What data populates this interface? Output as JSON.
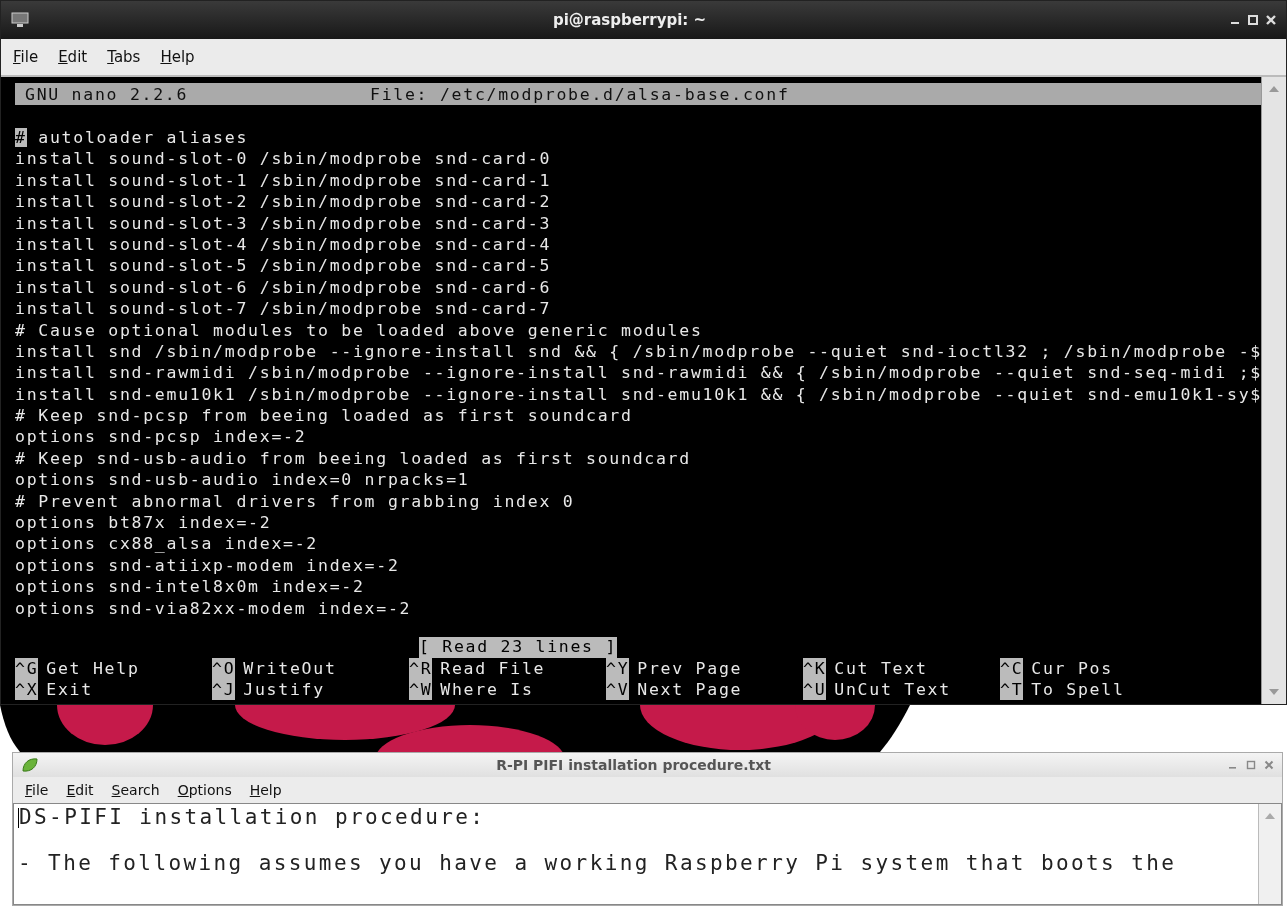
{
  "terminal_window": {
    "title": "pi@raspberrypi: ~",
    "menu": [
      {
        "label": "File"
      },
      {
        "label": "Edit"
      },
      {
        "label": "Tabs"
      },
      {
        "label": "Help"
      }
    ],
    "nano": {
      "version": "GNU nano 2.2.6",
      "file": "File: /etc/modprobe.d/alsa-base.conf",
      "lines": [
        {
          "text": "# autoloader aliases",
          "cursor": true
        },
        {
          "text": "install sound-slot-0 /sbin/modprobe snd-card-0",
          "cursor": false
        },
        {
          "text": "install sound-slot-1 /sbin/modprobe snd-card-1",
          "cursor": false
        },
        {
          "text": "install sound-slot-2 /sbin/modprobe snd-card-2",
          "cursor": false
        },
        {
          "text": "install sound-slot-3 /sbin/modprobe snd-card-3",
          "cursor": false
        },
        {
          "text": "install sound-slot-4 /sbin/modprobe snd-card-4",
          "cursor": false
        },
        {
          "text": "install sound-slot-5 /sbin/modprobe snd-card-5",
          "cursor": false
        },
        {
          "text": "install sound-slot-6 /sbin/modprobe snd-card-6",
          "cursor": false
        },
        {
          "text": "install sound-slot-7 /sbin/modprobe snd-card-7",
          "cursor": false
        },
        {
          "text": "# Cause optional modules to be loaded above generic modules",
          "cursor": false
        },
        {
          "text": "install snd /sbin/modprobe --ignore-install snd && { /sbin/modprobe --quiet snd-ioctl32 ; /sbin/modprobe -$",
          "cursor": false
        },
        {
          "text": "install snd-rawmidi /sbin/modprobe --ignore-install snd-rawmidi && { /sbin/modprobe --quiet snd-seq-midi ;$",
          "cursor": false
        },
        {
          "text": "install snd-emu10k1 /sbin/modprobe --ignore-install snd-emu10k1 && { /sbin/modprobe --quiet snd-emu10k1-sy$",
          "cursor": false
        },
        {
          "text": "# Keep snd-pcsp from beeing loaded as first soundcard",
          "cursor": false
        },
        {
          "text": "options snd-pcsp index=-2",
          "cursor": false
        },
        {
          "text": "# Keep snd-usb-audio from beeing loaded as first soundcard",
          "cursor": false
        },
        {
          "text": "options snd-usb-audio index=0 nrpacks=1",
          "cursor": false
        },
        {
          "text": "# Prevent abnormal drivers from grabbing index 0",
          "cursor": false
        },
        {
          "text": "options bt87x index=-2",
          "cursor": false
        },
        {
          "text": "options cx88_alsa index=-2",
          "cursor": false
        },
        {
          "text": "options snd-atiixp-modem index=-2",
          "cursor": false
        },
        {
          "text": "options snd-intel8x0m index=-2",
          "cursor": false
        },
        {
          "text": "options snd-via82xx-modem index=-2",
          "cursor": false
        }
      ],
      "status": "[ Read 23 lines ]",
      "shortcuts": [
        {
          "key": "^G",
          "label": "Get Help"
        },
        {
          "key": "^O",
          "label": "WriteOut"
        },
        {
          "key": "^R",
          "label": "Read File"
        },
        {
          "key": "^Y",
          "label": "Prev Page"
        },
        {
          "key": "^K",
          "label": "Cut Text"
        },
        {
          "key": "^C",
          "label": "Cur Pos"
        },
        {
          "key": "^X",
          "label": "Exit"
        },
        {
          "key": "^J",
          "label": "Justify"
        },
        {
          "key": "^W",
          "label": "Where Is"
        },
        {
          "key": "^V",
          "label": "Next Page"
        },
        {
          "key": "^U",
          "label": "UnCut Text"
        },
        {
          "key": "^T",
          "label": "To Spell"
        }
      ]
    }
  },
  "editor_window": {
    "title": "R-PI PIFI installation procedure.txt",
    "menu": [
      {
        "label": "File"
      },
      {
        "label": "Edit"
      },
      {
        "label": "Search"
      },
      {
        "label": "Options"
      },
      {
        "label": "Help"
      }
    ],
    "paragraphs": [
      {
        "text": "DS-PIFI installation procedure:",
        "cursor": true
      },
      {
        "text": "- The following assumes you have a working Raspberry Pi system that boots the",
        "cursor": false
      }
    ]
  }
}
